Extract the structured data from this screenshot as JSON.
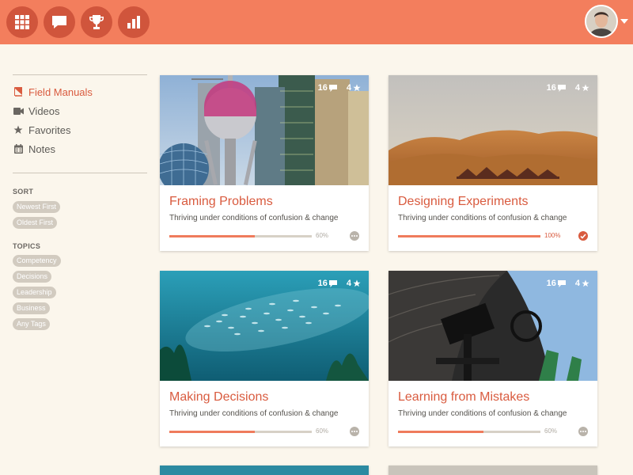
{
  "topbar": {
    "icons": [
      "grid-icon",
      "chat-icon",
      "trophy-icon",
      "bar-chart-icon"
    ],
    "color": "#f37e5d",
    "button_color": "#d0553c"
  },
  "sidebar": {
    "items": [
      {
        "label": "Field Manuals",
        "icon": "book-icon",
        "active": true
      },
      {
        "label": "Videos",
        "icon": "video-camera-icon",
        "active": false
      },
      {
        "label": "Favorites",
        "icon": "star-icon",
        "active": false
      },
      {
        "label": "Notes",
        "icon": "calendar-icon",
        "active": false
      }
    ],
    "sort": {
      "heading": "SORT",
      "options": [
        "Newest First",
        "Oldest First"
      ]
    },
    "topics": {
      "heading": "TOPICS",
      "tags": [
        "Competency",
        "Decisions",
        "Leadership",
        "Business",
        "Any Tags"
      ]
    }
  },
  "accent_color": "#d95b3f",
  "cards": [
    {
      "title": "Framing Problems",
      "subtitle": "Thriving under conditions of confusion & change",
      "comments": "16",
      "stars": "4",
      "progress": 0.6,
      "progress_label": "60%",
      "completed": false,
      "image": "city-skyline"
    },
    {
      "title": "Designing Experiments",
      "subtitle": "Thriving under conditions of confusion & change",
      "comments": "16",
      "stars": "4",
      "progress": 1.0,
      "progress_label": "100%",
      "completed": true,
      "image": "desert-dunes"
    },
    {
      "title": "Making Decisions",
      "subtitle": "Thriving under conditions of confusion & change",
      "comments": "16",
      "stars": "4",
      "progress": 0.6,
      "progress_label": "60%",
      "completed": false,
      "image": "fish-school"
    },
    {
      "title": "Learning from Mistakes",
      "subtitle": "Thriving under conditions of confusion & change",
      "comments": "16",
      "stars": "4",
      "progress": 0.6,
      "progress_label": "60%",
      "completed": false,
      "image": "observatory-telescope"
    }
  ]
}
